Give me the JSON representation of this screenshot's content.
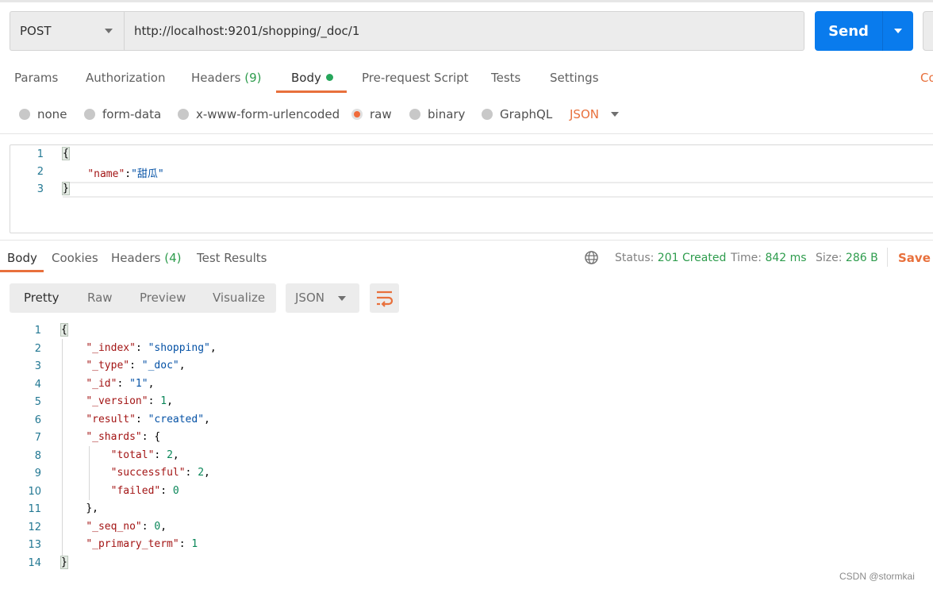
{
  "request": {
    "method": "POST",
    "url": "http://localhost:9201/shopping/_doc/1",
    "send_label": "Send"
  },
  "request_tabs": [
    {
      "label": "Params"
    },
    {
      "label": "Authorization"
    },
    {
      "label": "Headers",
      "count": "(9)"
    },
    {
      "label": "Body",
      "active": true,
      "indicator": "green-dot"
    },
    {
      "label": "Pre-request Script"
    },
    {
      "label": "Tests"
    },
    {
      "label": "Settings"
    }
  ],
  "cookies_link": "Co",
  "body_types": [
    {
      "label": "none"
    },
    {
      "label": "form-data"
    },
    {
      "label": "x-www-form-urlencoded"
    },
    {
      "label": "raw",
      "selected": true
    },
    {
      "label": "binary"
    },
    {
      "label": "GraphQL"
    }
  ],
  "body_language": "JSON",
  "request_body": {
    "line_numbers": [
      "1",
      "2",
      "3"
    ],
    "lines": [
      "{",
      "    \"name\":\"甜瓜\"",
      "}"
    ]
  },
  "response_tabs": [
    {
      "label": "Body",
      "active": true
    },
    {
      "label": "Cookies"
    },
    {
      "label": "Headers",
      "count": "(4)"
    },
    {
      "label": "Test Results"
    }
  ],
  "response_meta": {
    "status_label": "Status:",
    "status_value": "201 Created",
    "time_label": "Time:",
    "time_value": "842 ms",
    "size_label": "Size:",
    "size_value": "286 B",
    "save_label": "Save R"
  },
  "view_modes": [
    {
      "label": "Pretty",
      "active": true
    },
    {
      "label": "Raw"
    },
    {
      "label": "Preview"
    },
    {
      "label": "Visualize"
    }
  ],
  "response_format": "JSON",
  "response_body": {
    "line_numbers": [
      "1",
      "2",
      "3",
      "4",
      "5",
      "6",
      "7",
      "8",
      "9",
      "10",
      "11",
      "12",
      "13",
      "14"
    ],
    "lines": [
      "{",
      "    \"_index\": \"shopping\",",
      "    \"_type\": \"_doc\",",
      "    \"_id\": \"1\",",
      "    \"_version\": 1,",
      "    \"result\": \"created\",",
      "    \"_shards\": {",
      "        \"total\": 2,",
      "        \"successful\": 2,",
      "        \"failed\": 0",
      "    },",
      "    \"_seq_no\": 0,",
      "    \"_primary_term\": 1",
      "}"
    ]
  },
  "colors": {
    "accent": "#e8703c",
    "send_blue": "#097bed",
    "success_green": "#2e9c4d",
    "json_key": "#a31515",
    "json_string": "#0451a5",
    "json_number": "#098658"
  },
  "watermark": "CSDN @stormkai"
}
